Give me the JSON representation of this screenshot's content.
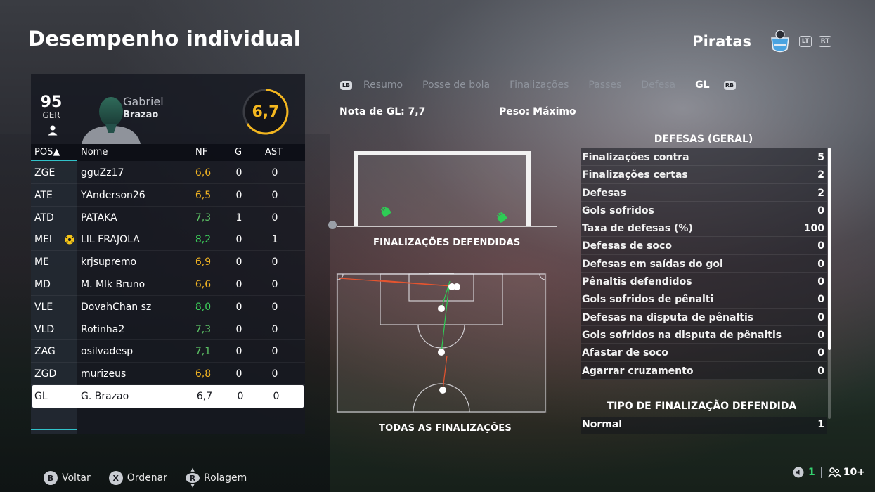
{
  "header": {
    "title": "Desempenho individual",
    "team_name": "Piratas",
    "lt": "LT",
    "rt": "RT"
  },
  "player": {
    "overall": "95",
    "position": "GER",
    "first_name": "Gabriel",
    "last_name": "Brazao",
    "rating": "6,7"
  },
  "table": {
    "headers": {
      "pos": "POS▲",
      "name": "Nome",
      "nf": "NF",
      "g": "G",
      "ast": "AST"
    },
    "rows": [
      {
        "pos": "ZGE",
        "name": "gguZz17",
        "nf": "6,6",
        "g": "0",
        "ast": "0",
        "nf_color": "#f0b323"
      },
      {
        "pos": "ATE",
        "name": "YAnderson26",
        "nf": "6,5",
        "g": "0",
        "ast": "0",
        "nf_color": "#f0b323"
      },
      {
        "pos": "ATD",
        "name": "PATAKA",
        "nf": "7,3",
        "g": "1",
        "ast": "0",
        "nf_color": "#5cc265"
      },
      {
        "pos": "MEI",
        "name": "LIL FRAJOLA",
        "nf": "8,2",
        "g": "0",
        "ast": "1",
        "nf_color": "#3ccf5a"
      },
      {
        "pos": "ME",
        "name": "krjsupremo",
        "nf": "6,9",
        "g": "0",
        "ast": "0",
        "nf_color": "#f0b323"
      },
      {
        "pos": "MD",
        "name": "M. Mlk Bruno",
        "nf": "6,6",
        "g": "0",
        "ast": "0",
        "nf_color": "#f0b323"
      },
      {
        "pos": "VLE",
        "name": "DovahChan sz",
        "nf": "8,0",
        "g": "0",
        "ast": "0",
        "nf_color": "#3ccf5a"
      },
      {
        "pos": "VLD",
        "name": "Rotinha2",
        "nf": "7,3",
        "g": "0",
        "ast": "0",
        "nf_color": "#5cc265"
      },
      {
        "pos": "ZAG",
        "name": "osilvadesp",
        "nf": "7,1",
        "g": "0",
        "ast": "0",
        "nf_color": "#5cc265"
      },
      {
        "pos": "ZGD",
        "name": "murizeus",
        "nf": "6,8",
        "g": "0",
        "ast": "0",
        "nf_color": "#f0b323"
      },
      {
        "pos": "GL",
        "name": "G. Brazao",
        "nf": "6,7",
        "g": "0",
        "ast": "0",
        "nf_color": "#15171d"
      }
    ]
  },
  "tabs": {
    "lb": "LB",
    "rb": "RB",
    "items": [
      "Resumo",
      "Posse de bola",
      "Finalizações",
      "Passes",
      "Defesa",
      "GL"
    ],
    "active": "GL"
  },
  "gk": {
    "rating_label": "Nota de GL: 7,7",
    "weight_label": "Peso: Máximo"
  },
  "diagrams": {
    "saved_label": "FINALIZAÇÕES DEFENDIDAS",
    "all_label": "TODAS AS FINALIZAÇÕES"
  },
  "stats": {
    "title": "DEFESAS (GERAL)",
    "rows": [
      {
        "label": "Finalizações contra",
        "value": "5"
      },
      {
        "label": "Finalizações certas",
        "value": "2"
      },
      {
        "label": "Defesas",
        "value": "2"
      },
      {
        "label": "Gols sofridos",
        "value": "0"
      },
      {
        "label": "Taxa de defesas (%)",
        "value": "100"
      },
      {
        "label": "Defesas de soco",
        "value": "0"
      },
      {
        "label": "Defesas em saídas do gol",
        "value": "0"
      },
      {
        "label": "Pênaltis defendidos",
        "value": "0"
      },
      {
        "label": "Gols sofridos de pênalti",
        "value": "0"
      },
      {
        "label": "Defesas na disputa de pênaltis",
        "value": "0"
      },
      {
        "label": "Gols sofridos na disputa de pênaltis",
        "value": "0"
      },
      {
        "label": "Afastar de soco",
        "value": "0"
      },
      {
        "label": "Agarrar cruzamento",
        "value": "0"
      }
    ],
    "types_title": "TIPO DE FINALIZAÇÃO DEFENDIDA",
    "types": [
      {
        "label": "Normal",
        "value": "1"
      }
    ]
  },
  "footer": {
    "back_key": "B",
    "back_label": "Voltar",
    "sort_key": "X",
    "sort_label": "Ordenar",
    "scroll_key": "R",
    "scroll_label": "Rolagem"
  },
  "network": {
    "count": "1",
    "players": "10+"
  },
  "colors": {
    "accent": "#31c2c9",
    "rating_ring": "#f3b61f",
    "save_icon": "#2ecc55",
    "green_status": "#35d36f"
  }
}
